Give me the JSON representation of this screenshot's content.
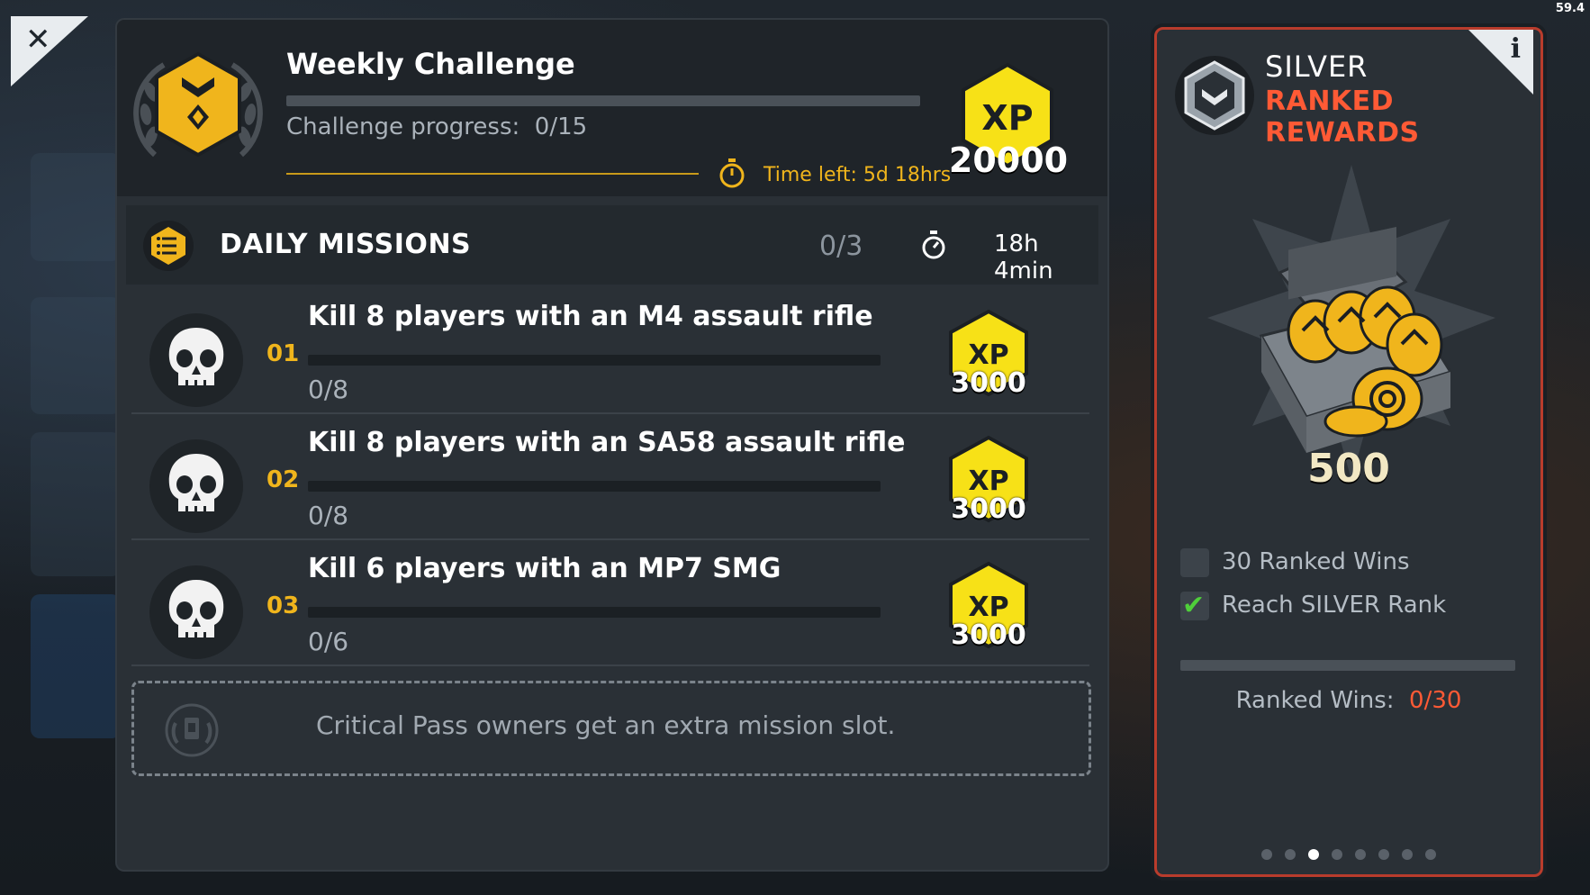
{
  "overlay": {
    "fps": "59.4"
  },
  "weekly": {
    "title": "Weekly Challenge",
    "progress_label": "Challenge progress:",
    "progress_value": "0/15",
    "progress_fraction": 0,
    "time_left": "Time left: 5d 18hrs",
    "xp_label": "XP",
    "xp_amount": "20000"
  },
  "daily": {
    "title": "DAILY MISSIONS",
    "count": "0/3",
    "time": "18h 4min"
  },
  "missions": [
    {
      "num": "01",
      "title": "Kill 8 players with an M4 assault rifle",
      "progress": "0/8",
      "xp_label": "XP",
      "xp": "3000"
    },
    {
      "num": "02",
      "title": "Kill 8 players with an SA58 assault rifle",
      "progress": "0/8",
      "xp_label": "XP",
      "xp": "3000"
    },
    {
      "num": "03",
      "title": "Kill 6 players with an MP7 SMG",
      "progress": "0/6",
      "xp_label": "XP",
      "xp": "3000"
    }
  ],
  "extra_slot": {
    "text": "Critical Pass owners get an extra mission slot."
  },
  "ranked": {
    "rank": "SILVER",
    "title": "RANKED REWARDS",
    "info": "i",
    "reward_amount": "500",
    "requirements": [
      {
        "text": "30 Ranked Wins",
        "done": false
      },
      {
        "text": "Reach SILVER Rank",
        "done": true
      }
    ],
    "wins_label": "Ranked Wins:",
    "wins_value": "0/30",
    "wins_fraction": 0,
    "pages": 8,
    "active_page": 3
  },
  "colors": {
    "accent_yellow": "#f0b51c",
    "accent_red": "#ff5a35",
    "check_green": "#4fcf3a"
  },
  "icons": {
    "close": "close-icon",
    "medal": "medal-icon",
    "skull": "skull-icon",
    "stopwatch": "stopwatch-icon",
    "checklist": "checklist-icon"
  }
}
